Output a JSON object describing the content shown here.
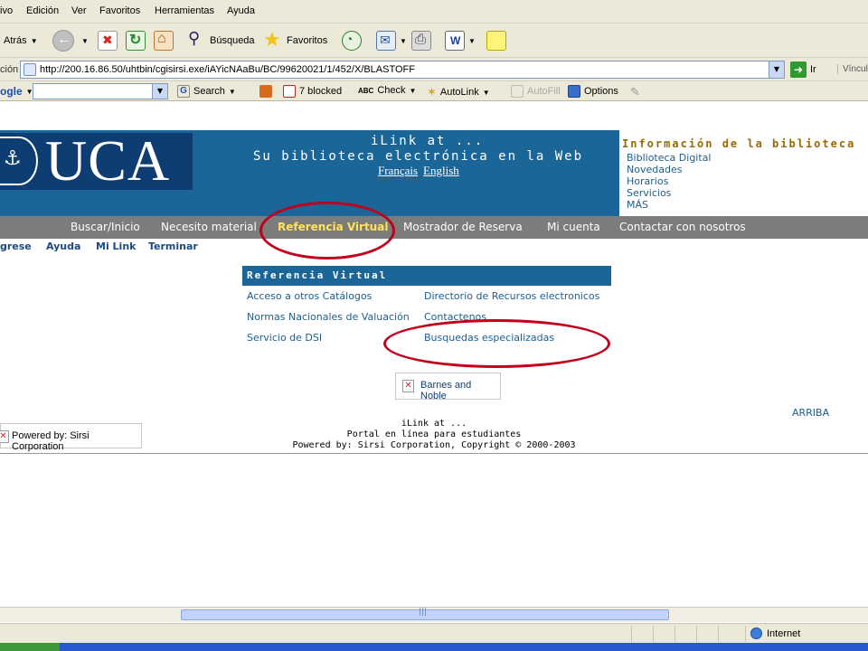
{
  "browser": {
    "menu": [
      "ivo",
      "Edición",
      "Ver",
      "Favoritos",
      "Herramientas",
      "Ayuda"
    ],
    "toolbar": {
      "back_label": "Atrás",
      "search_label": "Búsqueda",
      "favorites_label": "Favoritos"
    },
    "address": {
      "label": "ción",
      "url": "http://200.16.86.50/uhtbin/cgisirsi.exe/iAYicNAaBu/BC/99620021/1/452/X/BLASTOFF",
      "go_label": "Ir",
      "links_label": "Víncul"
    },
    "google_bar": {
      "brand": "ogle",
      "search_label": "Search",
      "blocked_label": "7 blocked",
      "check_label": "Check",
      "autolink_label": "AutoLink",
      "autofill_label": "AutoFill",
      "options_label": "Options"
    },
    "status": {
      "zone": "Internet"
    }
  },
  "page": {
    "logo_text": "UCA",
    "header_line1": "iLink at ...",
    "header_line2": "Su biblioteca electrónica en la Web",
    "languages": [
      "Français",
      "English"
    ],
    "info": {
      "title": "Información de la biblioteca",
      "links": [
        "Biblioteca Digital",
        "Novedades",
        "Horarios",
        "Servicios",
        "MÁS"
      ]
    },
    "nav": {
      "items": [
        "Buscar/Inicio",
        "Necesito material",
        "Referencia Virtual",
        "Mostrador de Reserva",
        "Mi cuenta",
        "Contactar con nosotros"
      ],
      "active": "Referencia Virtual"
    },
    "subnav": [
      "grese",
      "Ayuda",
      "Mi Link",
      "Terminar"
    ],
    "ref": {
      "title": "Referencia Virtual",
      "left_links": [
        "Acceso a otros Catálogos",
        "Normas Nacionales de Valuación",
        "Servicio de DSI"
      ],
      "right_links": [
        "Directorio de Recursos electronicos",
        "Contactenos",
        "Busquedas especializadas"
      ]
    },
    "barnes_label": "Barnes and Noble",
    "arriba": "ARRIBA",
    "powered_box": "Powered by: Sirsi Corporation",
    "footer": [
      "iLink at ...",
      "Portal en línea para estudiantes",
      "Powered by: Sirsi Corporation, Copyright © 2000-2003"
    ]
  },
  "colors": {
    "header_blue": "#1b6699",
    "nav_gray": "#7c7c7c",
    "active_yellow": "#ffe35a",
    "link_blue": "#1c5e8e",
    "annotation_red": "#c0001a"
  }
}
